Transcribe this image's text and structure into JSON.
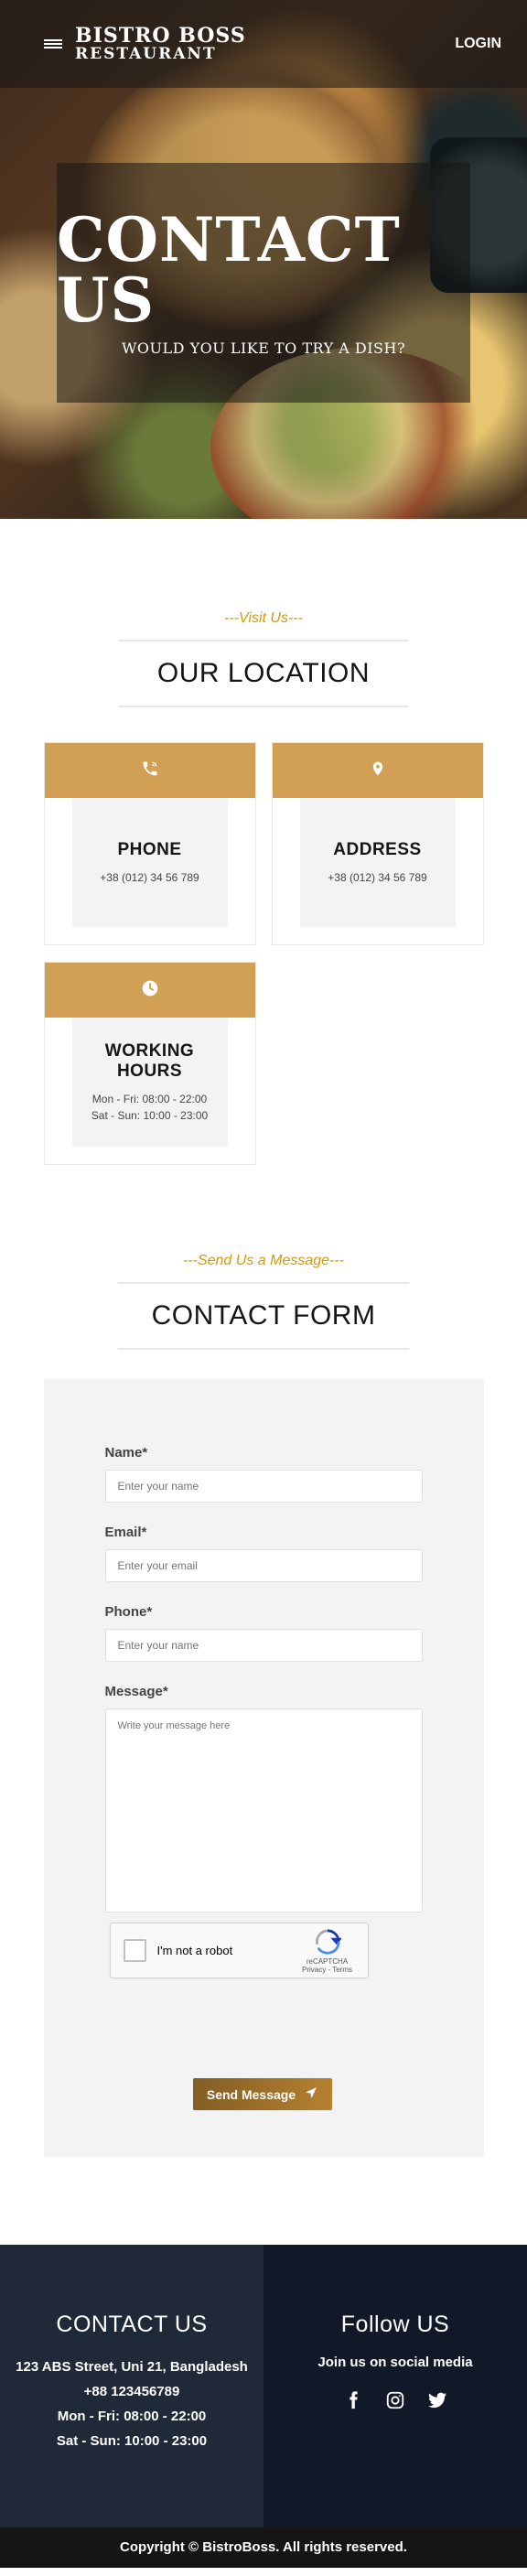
{
  "nav": {
    "brand_line1": "BISTRO BOSS",
    "brand_line2": "RESTAURANT",
    "login_label": "LOGIN",
    "menu_icon": "hamburger-menu-icon"
  },
  "hero": {
    "title": "CONTACT US",
    "subtitle": "WOULD YOU LIKE TO TRY A DISH?"
  },
  "location": {
    "subheading": "---Visit Us---",
    "heading": "OUR LOCATION",
    "cards": [
      {
        "icon": "phone-icon",
        "title": "PHONE",
        "lines": [
          "+38 (012) 34 56 789"
        ]
      },
      {
        "icon": "location-pin-icon",
        "title": "ADDRESS",
        "lines": [
          "+38 (012) 34 56 789"
        ]
      },
      {
        "icon": "clock-icon",
        "title": "WORKING HOURS",
        "lines": [
          "Mon - Fri: 08:00 - 22:00",
          "Sat - Sun: 10:00 - 23:00"
        ]
      }
    ]
  },
  "contact": {
    "subheading": "---Send Us a Message---",
    "heading": "CONTACT FORM",
    "fields": {
      "name": {
        "label": "Name*",
        "placeholder": "Enter your name",
        "value": ""
      },
      "email": {
        "label": "Email*",
        "placeholder": "Enter your email",
        "value": ""
      },
      "phone": {
        "label": "Phone*",
        "placeholder": "Enter your name",
        "value": ""
      },
      "message": {
        "label": "Message*",
        "placeholder": "Write your message here",
        "value": ""
      }
    },
    "captcha": {
      "label": "I'm not a robot",
      "brand": "reCAPTCHA",
      "links": "Privacy - Terms"
    },
    "send_label": "Send Message",
    "send_icon": "paper-plane-icon"
  },
  "footer": {
    "contact_heading": "CONTACT US",
    "contact_lines": [
      "123 ABS Street, Uni 21, Bangladesh",
      "+88 123456789",
      "Mon - Fri: 08:00 - 22:00",
      "Sat - Sun: 10:00 - 23:00"
    ],
    "follow_heading": "Follow US",
    "follow_text": "Join us on social media",
    "socials": [
      "facebook-icon",
      "instagram-icon",
      "twitter-icon"
    ],
    "copyright": "Copyright © BistroBoss. All rights reserved."
  },
  "colors": {
    "accent_gold": "#d1a054",
    "subheading_gold": "#d99904",
    "footer_left": "#1f2937",
    "footer_right": "#111827"
  }
}
